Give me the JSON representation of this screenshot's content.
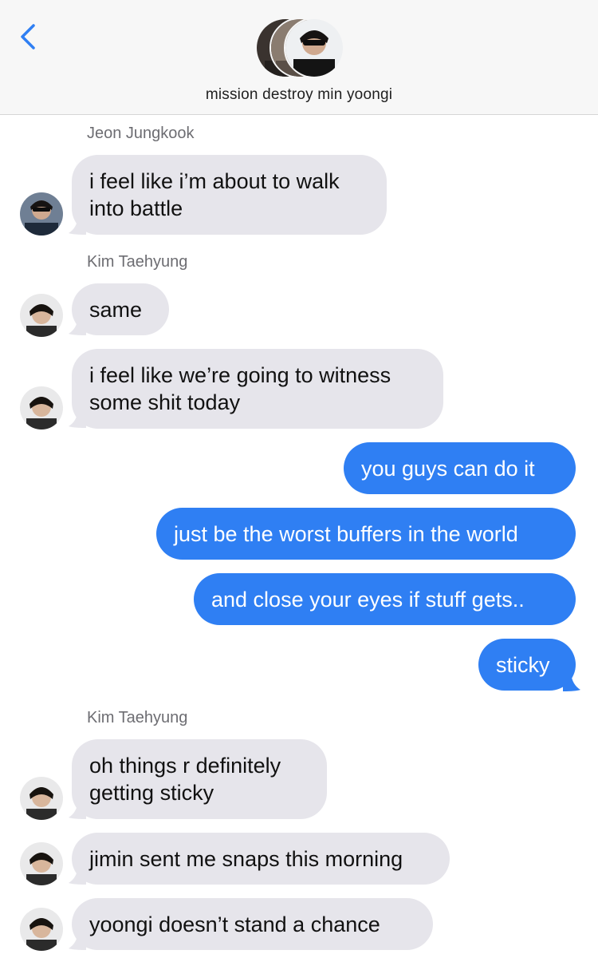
{
  "header": {
    "back_icon": "chevron-left-icon",
    "group_name": "mission destroy min yoongi",
    "accent": "#2f7ff3"
  },
  "messages": [
    {
      "sender": "Jeon Jungkook",
      "text": [
        "i feel like i’m about to walk",
        "into battle"
      ],
      "direction": "incoming"
    },
    {
      "sender": "Kim Taehyung",
      "text": [
        "same"
      ],
      "direction": "incoming"
    },
    {
      "text": [
        "i feel like we’re going to witness",
        "some shit today"
      ],
      "direction": "incoming"
    },
    {
      "text": [
        "you guys can do it"
      ],
      "direction": "outgoing"
    },
    {
      "text": [
        "just be the worst buffers in the world"
      ],
      "direction": "outgoing"
    },
    {
      "text": [
        "and close your eyes if stuff gets.."
      ],
      "direction": "outgoing"
    },
    {
      "text": [
        "sticky"
      ],
      "direction": "outgoing"
    },
    {
      "sender": "Kim Taehyung",
      "text": [
        "oh things r definitely",
        "getting sticky"
      ],
      "direction": "incoming"
    },
    {
      "text": [
        "jimin sent me snaps this morning"
      ],
      "direction": "incoming"
    },
    {
      "text": [
        "yoongi doesn’t stand a chance"
      ],
      "direction": "incoming"
    }
  ],
  "colors": {
    "incoming_bubble": "#e6e5eb",
    "outgoing_bubble": "#2f7ff3",
    "sender_label": "#6d6d72"
  }
}
